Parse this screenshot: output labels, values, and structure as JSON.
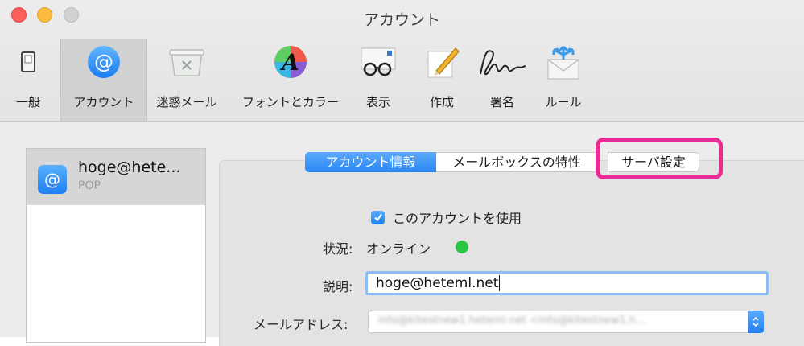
{
  "window": {
    "title": "アカウント"
  },
  "toolbar": {
    "items": [
      {
        "label": "一般",
        "icon": "switch-icon"
      },
      {
        "label": "アカウント",
        "icon": "at-icon",
        "selected": true
      },
      {
        "label": "迷惑メール",
        "icon": "junk-icon"
      },
      {
        "label": "フォントとカラー",
        "icon": "font-color-icon"
      },
      {
        "label": "表示",
        "icon": "glasses-icon"
      },
      {
        "label": "作成",
        "icon": "pencil-icon"
      },
      {
        "label": "署名",
        "icon": "signature-icon"
      },
      {
        "label": "ルール",
        "icon": "rules-icon"
      }
    ]
  },
  "accounts": [
    {
      "name": "hoge@hete...",
      "type": "POP"
    }
  ],
  "tabs": [
    {
      "label": "アカウント情報",
      "selected": true
    },
    {
      "label": "メールボックスの特性",
      "selected": false
    },
    {
      "label": "サーバ設定",
      "selected": false,
      "highlighted": true
    }
  ],
  "form": {
    "enable_checkbox_label": "このアカウントを使用",
    "enable_checked": true,
    "status_label": "状況:",
    "status_value": "オンライン",
    "description_label": "説明:",
    "description_value": "hoge@heteml.net",
    "email_label": "メールアドレス:",
    "email_value": "info@kitestnew1.heteml.net <info@kitestnew1.h..."
  },
  "colors": {
    "accent": "#2a87f3",
    "highlight": "#ea2b94",
    "status_online": "#2bc641"
  }
}
